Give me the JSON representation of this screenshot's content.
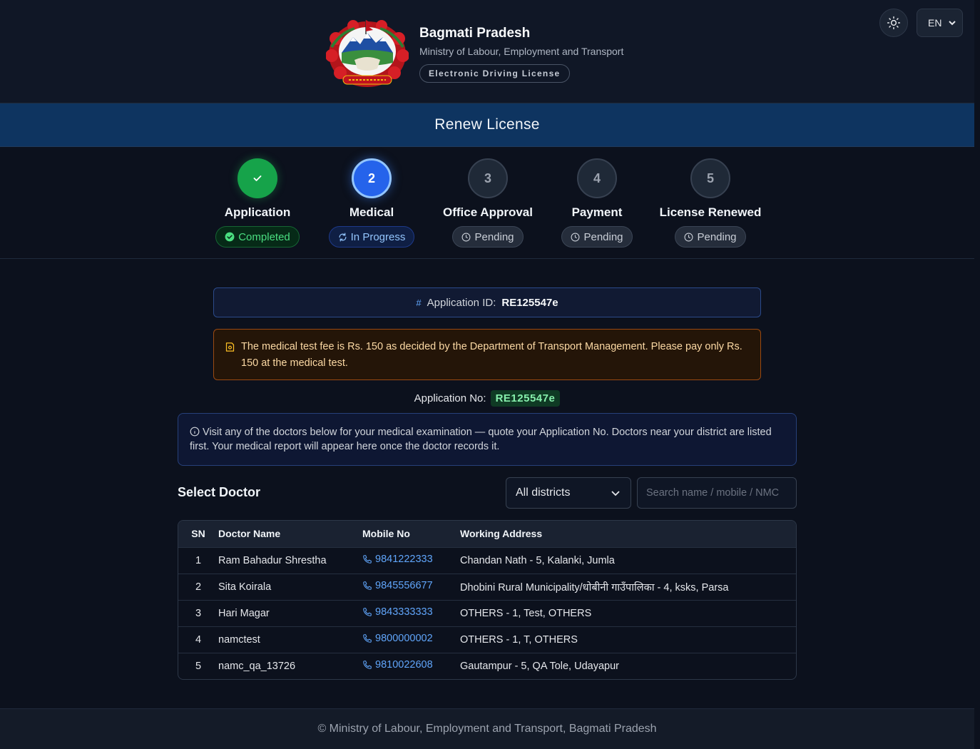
{
  "header": {
    "title": "Bagmati Pradesh",
    "subtitle": "Ministry of Labour, Employment and Transport",
    "badge": "Electronic Driving License",
    "theme_icon": "sun-icon",
    "language": "EN"
  },
  "banner": {
    "title": "Renew License"
  },
  "steps": [
    {
      "number": "",
      "label": "Application",
      "status": "Completed",
      "state": "done"
    },
    {
      "number": "2",
      "label": "Medical",
      "status": "In Progress",
      "state": "active"
    },
    {
      "number": "3",
      "label": "Office Approval",
      "status": "Pending",
      "state": "pending"
    },
    {
      "number": "4",
      "label": "Payment",
      "status": "Pending",
      "state": "pending"
    },
    {
      "number": "5",
      "label": "License Renewed",
      "status": "Pending",
      "state": "pending"
    }
  ],
  "application_id": {
    "hash": "#",
    "label": "Application ID:",
    "value": "RE125547e"
  },
  "fee_notice": "The medical test fee is Rs. 150 as decided by the Department of Transport Management. Please pay only Rs. 150 at the medical test.",
  "application_no": {
    "label": "Application No:",
    "value": "RE125547e"
  },
  "info": "Visit any of the doctors below for your medical examination — quote your Application No. Doctors near your district are listed first. Your medical report will appear here once the doctor records it.",
  "select_doctor": {
    "title": "Select Doctor",
    "district_value": "All districts",
    "search_placeholder": "Search name / mobile / NMC"
  },
  "table": {
    "headers": [
      "SN",
      "Doctor Name",
      "Mobile No",
      "Working Address"
    ],
    "rows": [
      [
        "1",
        "Ram Bahadur Shrestha",
        "9841222333",
        "Chandan Nath - 5, Kalanki, Jumla"
      ],
      [
        "2",
        "Sita Koirala",
        "9845556677",
        "Dhobini Rural Municipality/धोबीनी गाउँपालिका - 4, ksks, Parsa"
      ],
      [
        "3",
        "Hari Magar",
        "9843333333",
        "OTHERS - 1, Test, OTHERS"
      ],
      [
        "4",
        "namctest",
        "9800000002",
        "OTHERS - 1, T, OTHERS"
      ],
      [
        "5",
        "namc_qa_13726",
        "9810022608",
        "Gautampur - 5, QA Tole, Udayapur"
      ]
    ]
  },
  "footer": "© Ministry of Labour, Employment and Transport, Bagmati Pradesh",
  "colors": {
    "accent": "#2563eb",
    "success": "#16a34a",
    "banner": "#0e3460",
    "warning_border": "#9a4a12"
  }
}
